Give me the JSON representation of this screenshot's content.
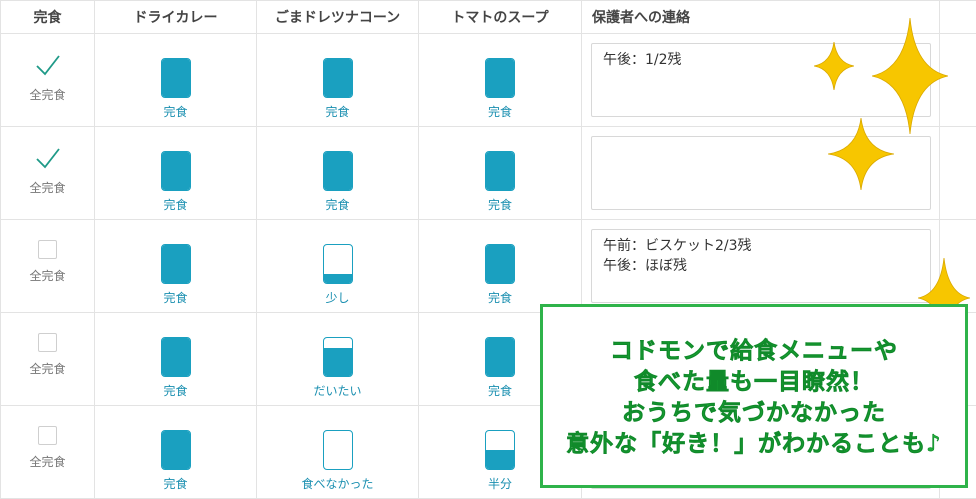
{
  "header": {
    "complete": "完食",
    "dishes": [
      "ドライカレー",
      "ごまドレツナコーン",
      "トマトのスープ"
    ],
    "memo": "保護者への連絡"
  },
  "rows": [
    {
      "all_done_label": "全完食",
      "checked": true,
      "dishes": [
        {
          "label": "完食",
          "level": 1.0
        },
        {
          "label": "完食",
          "level": 1.0
        },
        {
          "label": "完食",
          "level": 1.0
        }
      ],
      "memo": [
        "午後：1/2残"
      ]
    },
    {
      "all_done_label": "全完食",
      "checked": true,
      "dishes": [
        {
          "label": "完食",
          "level": 1.0
        },
        {
          "label": "完食",
          "level": 1.0
        },
        {
          "label": "完食",
          "level": 1.0
        }
      ],
      "memo": []
    },
    {
      "all_done_label": "全完食",
      "checked": false,
      "dishes": [
        {
          "label": "完食",
          "level": 1.0
        },
        {
          "label": "少し",
          "level": 0.25
        },
        {
          "label": "完食",
          "level": 1.0
        }
      ],
      "memo": [
        "午前：ビスケット2/3残",
        "午後：ほぼ残"
      ]
    },
    {
      "all_done_label": "全完食",
      "checked": false,
      "dishes": [
        {
          "label": "完食",
          "level": 1.0
        },
        {
          "label": "だいたい",
          "level": 0.75
        },
        {
          "label": "完食",
          "level": 1.0
        }
      ],
      "memo": []
    },
    {
      "all_done_label": "全完食",
      "checked": false,
      "dishes": [
        {
          "label": "完食",
          "level": 1.0
        },
        {
          "label": "食べなかった",
          "level": 0.0
        },
        {
          "label": "半分",
          "level": 0.5
        }
      ],
      "memo": []
    }
  ],
  "promo": {
    "lines": [
      "コドモンで給食メニューや",
      "食べた量も一目瞭然！",
      "おうちで気づかなかった",
      "意外な「好き！」がわかることも♪"
    ]
  },
  "colors": {
    "accent": "#1aa0c0",
    "check": "#1f9a88",
    "promo_green": "#1fae3a",
    "sparkle": "#f7c600"
  }
}
